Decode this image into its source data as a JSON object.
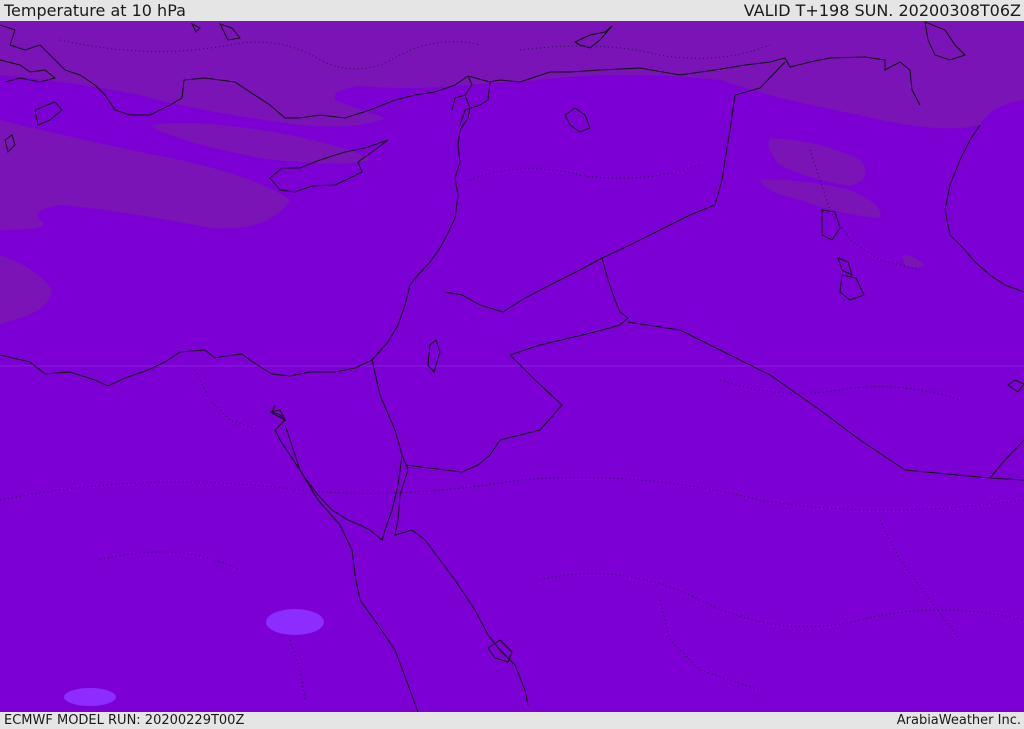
{
  "header": {
    "title": "Temperature at 10 hPa",
    "valid_time": "VALID T+198 SUN. 20200308T06Z"
  },
  "footer": {
    "model_run": "ECMWF MODEL RUN: 20200229T00Z",
    "credit": "ArabiaWeather Inc."
  },
  "map": {
    "fill_color": "#7c00d4",
    "warm_band_color": "#7a14b6",
    "cool_blob_color": "#8c2cff",
    "coast_color": "#111111"
  }
}
